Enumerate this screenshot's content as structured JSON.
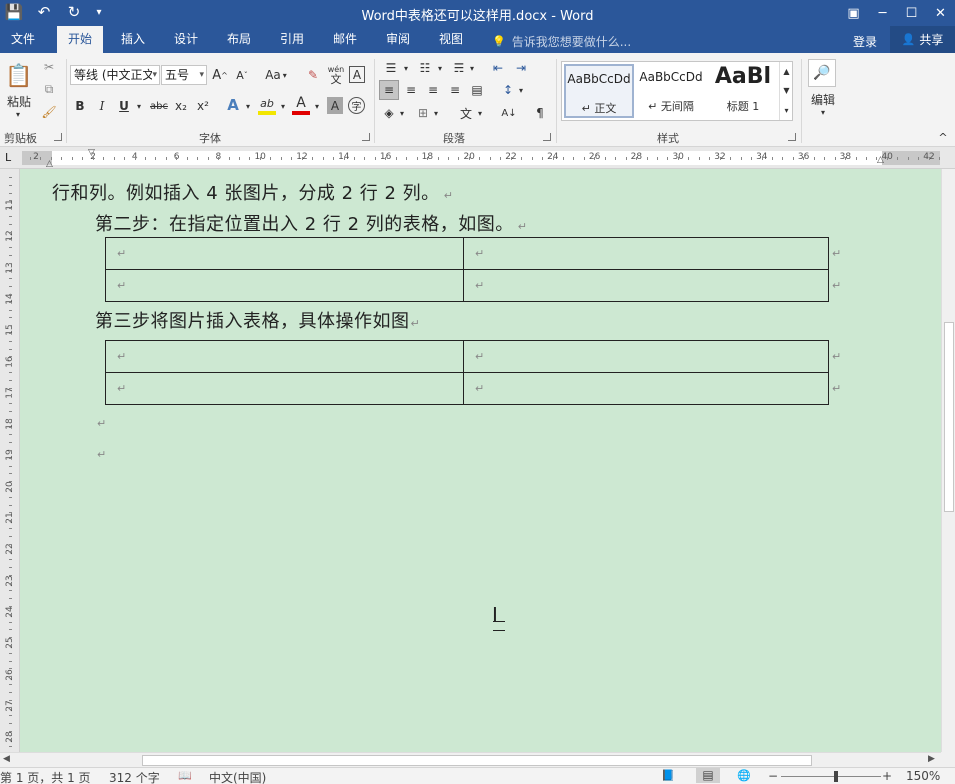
{
  "window": {
    "title": "Word中表格还可以这样用.docx - Word",
    "min_glyph": "─",
    "max_glyph": "☐",
    "close_glyph": "✕",
    "ribbon_toggle_glyph": "▣"
  },
  "qat": {
    "save_glyph": "💾",
    "undo_glyph": "↶",
    "redo_glyph": "↻",
    "customize_glyph": "▾"
  },
  "tabs": [
    {
      "label": "文件"
    },
    {
      "label": "开始"
    },
    {
      "label": "插入"
    },
    {
      "label": "设计"
    },
    {
      "label": "布局"
    },
    {
      "label": "引用"
    },
    {
      "label": "邮件"
    },
    {
      "label": "审阅"
    },
    {
      "label": "视图"
    }
  ],
  "tellme": {
    "glyph": "💡",
    "text": "告诉我您想要做什么..."
  },
  "account": {
    "login": "登录",
    "share": "共享",
    "share_glyph": "👤"
  },
  "ribbon": {
    "clipboard": {
      "label": "剪贴板",
      "paste": "粘贴",
      "paste_glyph": "📋",
      "cut_glyph": "✂",
      "copy_glyph": "⧉",
      "format_painter_glyph": "🖌"
    },
    "font": {
      "label": "字体",
      "font_name": "等线 (中文正文",
      "font_size": "五号",
      "grow": "A",
      "shrink": "A",
      "grow_sup": "^",
      "shrink_sup": "ˇ",
      "change_case": "Aa",
      "clear_format_glyph": "✎",
      "phonetic_top": "wén",
      "phonetic_bottom": "文",
      "char_border": "A",
      "bold": "B",
      "italic": "I",
      "underline": "U",
      "strike": "abc",
      "sub": "x₂",
      "sup": "x²",
      "effects": "A",
      "highlight": "ab",
      "font_color": "A",
      "char_shade": "A",
      "enclose": "字"
    },
    "paragraph": {
      "label": "段落",
      "bullets_glyph": "☰",
      "numbering_glyph": "☷",
      "multilevel_glyph": "☴",
      "decrease_indent_glyph": "⇤",
      "increase_indent_glyph": "⇥",
      "align_left_glyph": "≡",
      "align_center_glyph": "≡",
      "align_right_glyph": "≡",
      "justify_glyph": "≡",
      "distributed_glyph": "▤",
      "line_spacing_glyph": "↕",
      "shading_glyph": "◈",
      "borders_glyph": "⊞",
      "chinese_layout_glyph": "文",
      "sort_glyph": "A↓",
      "show_marks_glyph": "¶"
    },
    "styles": {
      "label": "样式",
      "items": [
        {
          "sample": "AaBbCcDd",
          "name": "↵ 正文"
        },
        {
          "sample": "AaBbCcDd",
          "name": "↵ 无间隔"
        },
        {
          "sample": "AaBl",
          "name": "标题 1"
        }
      ]
    },
    "editing": {
      "label": "编辑",
      "glyph": "🔎"
    },
    "collapse_glyph": "^"
  },
  "ruler": {
    "h_labels": [
      "2",
      "2",
      "4",
      "6",
      "8",
      "10",
      "12",
      "14",
      "16",
      "18",
      "20",
      "22",
      "24",
      "26",
      "28",
      "30",
      "32",
      "34",
      "36",
      "38",
      "40",
      "42"
    ],
    "v_labels": [
      "11",
      "12",
      "13",
      "14",
      "15",
      "16",
      "17",
      "18",
      "19",
      "20",
      "21",
      "22",
      "23",
      "24",
      "25",
      "26",
      "27",
      "28"
    ],
    "tab_selector": "L"
  },
  "document": {
    "line1": "行和列。例如插入 4 张图片，分成 2 行 2 列。",
    "line2": "第二步：在指定位置出入 2 行 2 列的表格，如图。",
    "line3": "第三步将图片插入表格，具体操作如图",
    "mark": "↵",
    "table1": [
      [
        "↵",
        "↵"
      ],
      [
        "↵",
        "↵"
      ]
    ],
    "table2": [
      [
        "↵",
        "↵"
      ],
      [
        "↵",
        "↵"
      ]
    ],
    "cursor_glyph": "I"
  },
  "statusbar": {
    "page": "第 1 页，共 1 页",
    "words": "312 个字",
    "proof_glyph": "📖",
    "language": "中文(中国)",
    "read_mode_glyph": "📘",
    "print_layout_glyph": "▤",
    "web_layout_glyph": "🌐",
    "zoom_out": "−",
    "zoom_in": "+",
    "zoom_level": "150%",
    "zoom_fraction": 0.55
  },
  "scrollbar": {
    "left_arrow": "◀",
    "right_arrow": "▶"
  }
}
